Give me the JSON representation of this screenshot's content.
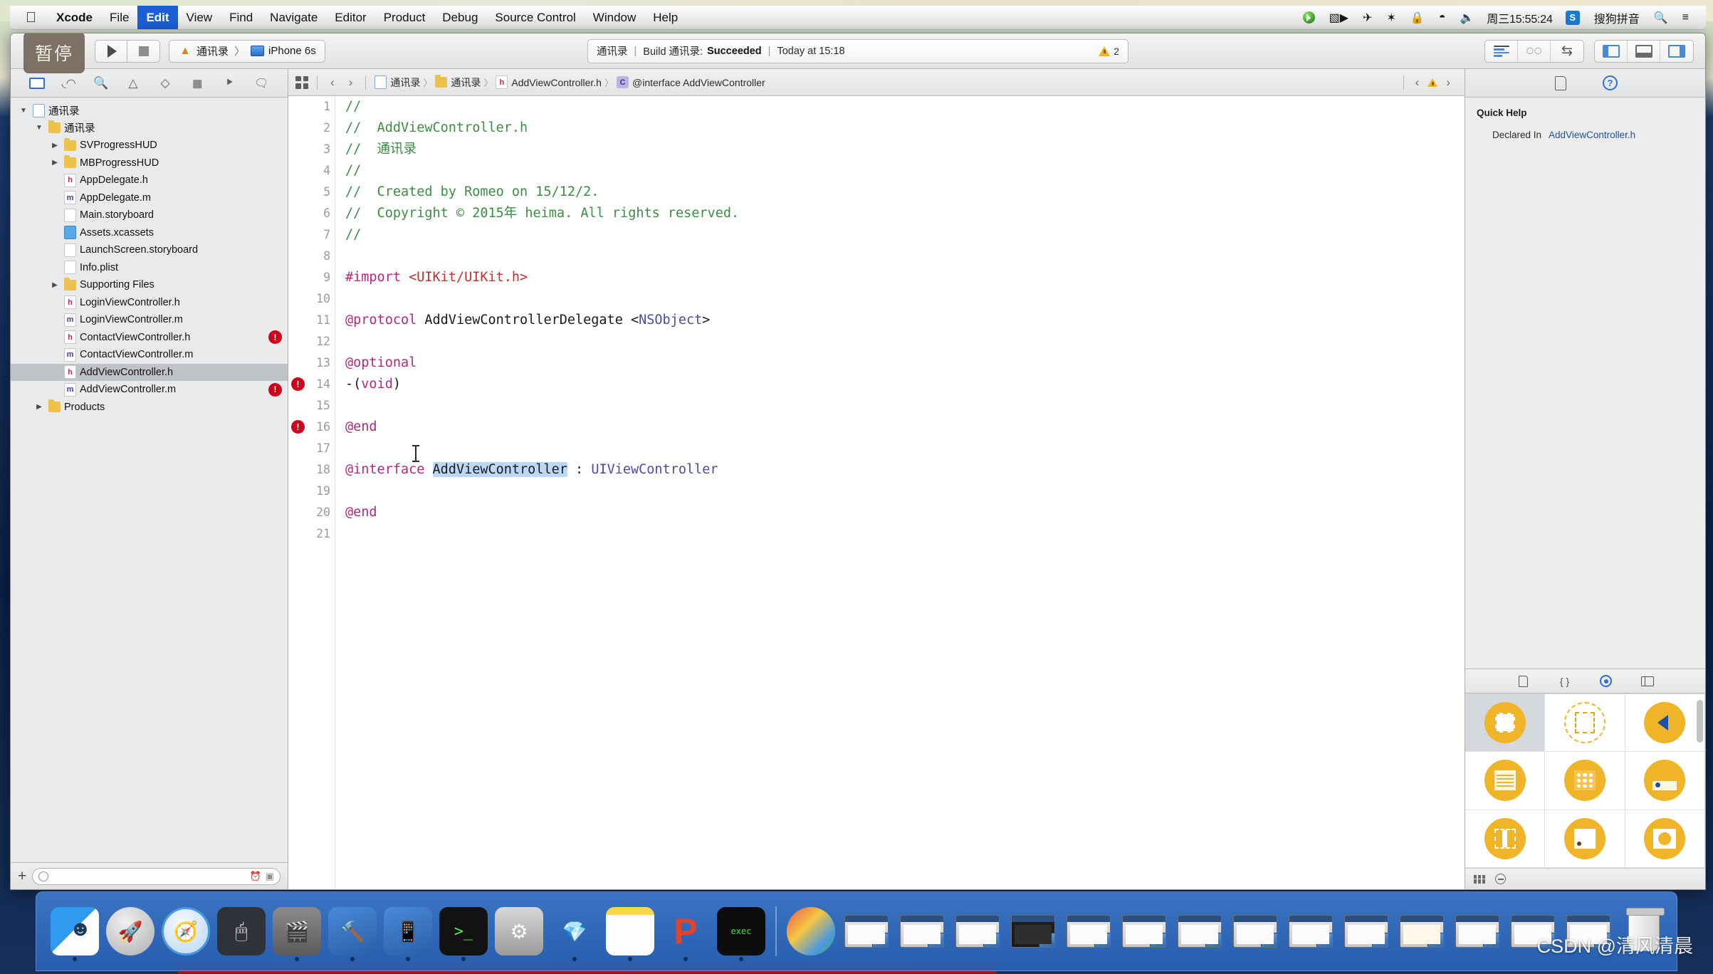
{
  "menubar": {
    "apple_icon": "apple-icon",
    "items": [
      {
        "label": "Xcode",
        "bold": true,
        "active": false
      },
      {
        "label": "File",
        "bold": false,
        "active": false
      },
      {
        "label": "Edit",
        "bold": false,
        "active": true
      },
      {
        "label": "View",
        "bold": false,
        "active": false
      },
      {
        "label": "Find",
        "bold": false,
        "active": false
      },
      {
        "label": "Navigate",
        "bold": false,
        "active": false
      },
      {
        "label": "Editor",
        "bold": false,
        "active": false
      },
      {
        "label": "Product",
        "bold": false,
        "active": false
      },
      {
        "label": "Debug",
        "bold": false,
        "active": false
      },
      {
        "label": "Source Control",
        "bold": false,
        "active": false
      },
      {
        "label": "Window",
        "bold": false,
        "active": false
      },
      {
        "label": "Help",
        "bold": false,
        "active": false
      }
    ],
    "status": {
      "screen_record_icon": "screen-record-icon",
      "airplane_icon": "airplane-mode-icon",
      "bluetooth_icon": "bluetooth-icon",
      "lock_icon": "lock-icon",
      "wifi_icon": "wifi-icon",
      "volume_icon": "volume-icon",
      "clock": "周三15:55:24",
      "input_method_badge": "S",
      "input_method": "搜狗拼音",
      "search_icon": "spotlight-search-icon",
      "notification_icon": "notification-center-icon"
    }
  },
  "toolbar": {
    "pause_tooltip": "暂停",
    "run_label": "run-button",
    "stop_label": "stop-button",
    "scheme": {
      "target": "通讯录",
      "separator": "〉",
      "destination": "iPhone 6s"
    },
    "status_bar": {
      "project": "通讯录",
      "sep": "|",
      "build_text": "Build 通讯录:",
      "result": "Succeeded",
      "time": "Today at 15:18",
      "warning_count": "2"
    },
    "editor_modes": [
      "standard-editor",
      "assistant-editor",
      "version-editor"
    ],
    "view_toggles": [
      "navigator-toggle",
      "debug-area-toggle",
      "utilities-toggle"
    ]
  },
  "navigator": {
    "tabs": [
      "project-navigator",
      "symbol-navigator",
      "find-navigator",
      "issue-navigator",
      "test-navigator",
      "debug-navigator",
      "breakpoint-navigator",
      "report-navigator"
    ],
    "tree": [
      {
        "label": "通讯录",
        "indent": 0,
        "twisty": "open",
        "icon": "proj",
        "selected": false,
        "error": false
      },
      {
        "label": "通讯录",
        "indent": 1,
        "twisty": "open",
        "icon": "folder",
        "selected": false,
        "error": false
      },
      {
        "label": "SVProgressHUD",
        "indent": 2,
        "twisty": "closed",
        "icon": "folder",
        "selected": false,
        "error": false
      },
      {
        "label": "MBProgressHUD",
        "indent": 2,
        "twisty": "closed",
        "icon": "folder",
        "selected": false,
        "error": false
      },
      {
        "label": "AppDelegate.h",
        "indent": 2,
        "twisty": "none",
        "icon": "h",
        "selected": false,
        "error": false
      },
      {
        "label": "AppDelegate.m",
        "indent": 2,
        "twisty": "none",
        "icon": "m",
        "selected": false,
        "error": false
      },
      {
        "label": "Main.storyboard",
        "indent": 2,
        "twisty": "none",
        "icon": "sb",
        "selected": false,
        "error": false
      },
      {
        "label": "Assets.xcassets",
        "indent": 2,
        "twisty": "none",
        "icon": "xc",
        "selected": false,
        "error": false
      },
      {
        "label": "LaunchScreen.storyboard",
        "indent": 2,
        "twisty": "none",
        "icon": "sb",
        "selected": false,
        "error": false
      },
      {
        "label": "Info.plist",
        "indent": 2,
        "twisty": "none",
        "icon": "plist",
        "selected": false,
        "error": false
      },
      {
        "label": "Supporting Files",
        "indent": 2,
        "twisty": "closed",
        "icon": "folder",
        "selected": false,
        "error": false
      },
      {
        "label": "LoginViewController.h",
        "indent": 2,
        "twisty": "none",
        "icon": "h",
        "selected": false,
        "error": false
      },
      {
        "label": "LoginViewController.m",
        "indent": 2,
        "twisty": "none",
        "icon": "m",
        "selected": false,
        "error": false
      },
      {
        "label": "ContactViewController.h",
        "indent": 2,
        "twisty": "none",
        "icon": "h",
        "selected": false,
        "error": true
      },
      {
        "label": "ContactViewController.m",
        "indent": 2,
        "twisty": "none",
        "icon": "m",
        "selected": false,
        "error": false
      },
      {
        "label": "AddViewController.h",
        "indent": 2,
        "twisty": "none",
        "icon": "h",
        "selected": true,
        "error": false
      },
      {
        "label": "AddViewController.m",
        "indent": 2,
        "twisty": "none",
        "icon": "m",
        "selected": false,
        "error": true
      },
      {
        "label": "Products",
        "indent": 1,
        "twisty": "closed",
        "icon": "folder",
        "selected": false,
        "error": false
      }
    ],
    "filter_placeholder": ""
  },
  "jumpbar": {
    "back_arrow": "‹",
    "forward_arrow": "›",
    "breadcrumb": [
      {
        "label": "通讯录",
        "icon": "proj"
      },
      {
        "label": "通讯录",
        "icon": "folder"
      },
      {
        "label": "AddViewController.h",
        "icon": "h"
      },
      {
        "label": "@interface AddViewController",
        "icon": "interface"
      }
    ],
    "issue_prev": "‹",
    "issue_next": "›"
  },
  "editor": {
    "filename": "AddViewController.h",
    "lines": [
      {
        "n": 1,
        "error": false,
        "tokens": [
          {
            "t": "//",
            "c": "cm"
          }
        ]
      },
      {
        "n": 2,
        "error": false,
        "tokens": [
          {
            "t": "//  AddViewController.h",
            "c": "cm"
          }
        ]
      },
      {
        "n": 3,
        "error": false,
        "tokens": [
          {
            "t": "//  通讯录",
            "c": "cm"
          }
        ]
      },
      {
        "n": 4,
        "error": false,
        "tokens": [
          {
            "t": "//",
            "c": "cm"
          }
        ]
      },
      {
        "n": 5,
        "error": false,
        "tokens": [
          {
            "t": "//  Created by Romeo on 15/12/2.",
            "c": "cm"
          }
        ]
      },
      {
        "n": 6,
        "error": false,
        "tokens": [
          {
            "t": "//  Copyright © 2015年 heima. All rights reserved.",
            "c": "cm"
          }
        ]
      },
      {
        "n": 7,
        "error": false,
        "tokens": [
          {
            "t": "//",
            "c": "cm"
          }
        ]
      },
      {
        "n": 8,
        "error": false,
        "tokens": []
      },
      {
        "n": 9,
        "error": false,
        "tokens": [
          {
            "t": "#import ",
            "c": "kw"
          },
          {
            "t": "<UIKit/UIKit.h>",
            "c": "str"
          }
        ]
      },
      {
        "n": 10,
        "error": false,
        "tokens": []
      },
      {
        "n": 11,
        "error": false,
        "tokens": [
          {
            "t": "@protocol",
            "c": "kw"
          },
          {
            "t": " AddViewControllerDelegate ",
            "c": "plain"
          },
          {
            "t": "<",
            "c": "plain"
          },
          {
            "t": "NSObject",
            "c": "typ"
          },
          {
            "t": ">",
            "c": "plain"
          }
        ]
      },
      {
        "n": 12,
        "error": false,
        "tokens": []
      },
      {
        "n": 13,
        "error": false,
        "tokens": [
          {
            "t": "@optional",
            "c": "kw"
          }
        ]
      },
      {
        "n": 14,
        "error": true,
        "tokens": [
          {
            "t": "-(",
            "c": "plain"
          },
          {
            "t": "void",
            "c": "kw"
          },
          {
            "t": ")",
            "c": "plain"
          }
        ]
      },
      {
        "n": 15,
        "error": false,
        "tokens": []
      },
      {
        "n": 16,
        "error": true,
        "tokens": [
          {
            "t": "@end",
            "c": "kw"
          }
        ]
      },
      {
        "n": 17,
        "error": false,
        "tokens": []
      },
      {
        "n": 18,
        "error": false,
        "tokens": [
          {
            "t": "@interface",
            "c": "kw"
          },
          {
            "t": " ",
            "c": "plain"
          },
          {
            "t": "AddViewController",
            "c": "plain sel-token"
          },
          {
            "t": " : ",
            "c": "plain"
          },
          {
            "t": "UIViewController",
            "c": "typ"
          }
        ]
      },
      {
        "n": 19,
        "error": false,
        "tokens": []
      },
      {
        "n": 20,
        "error": false,
        "tokens": [
          {
            "t": "@end",
            "c": "kw"
          }
        ]
      },
      {
        "n": 21,
        "error": false,
        "tokens": []
      }
    ]
  },
  "inspector": {
    "tabs": [
      "file-inspector",
      "quick-help-inspector"
    ],
    "quick_help": {
      "title": "Quick Help",
      "declared_in_label": "Declared In",
      "declared_in_value": "AddViewController.h"
    },
    "library": {
      "tabs": [
        "file-template-library",
        "code-snippet-library",
        "object-library",
        "media-library"
      ],
      "objects": [
        {
          "name": "view-controller",
          "selected": true
        },
        {
          "name": "storyboard-reference",
          "selected": false
        },
        {
          "name": "navigation-controller",
          "selected": false
        },
        {
          "name": "table-view-controller",
          "selected": false
        },
        {
          "name": "collection-view-controller",
          "selected": false
        },
        {
          "name": "tab-bar-controller",
          "selected": false
        },
        {
          "name": "split-view-controller",
          "selected": false
        },
        {
          "name": "page-view-controller",
          "selected": false
        },
        {
          "name": "glkit-view-controller",
          "selected": false
        }
      ]
    }
  },
  "dock": {
    "items": [
      {
        "name": "finder",
        "cls": "ic-finder",
        "glyph": "",
        "running": true,
        "type": "app"
      },
      {
        "name": "launchpad",
        "cls": "ic-launch",
        "glyph": "🚀",
        "running": false,
        "type": "app"
      },
      {
        "name": "safari",
        "cls": "ic-safari",
        "glyph": "🧭",
        "running": false,
        "type": "app"
      },
      {
        "name": "mouse-utility",
        "cls": "ic-mouse",
        "glyph": "🖱",
        "running": false,
        "type": "app"
      },
      {
        "name": "imovie",
        "cls": "ic-imovie",
        "glyph": "🎬",
        "running": true,
        "type": "app"
      },
      {
        "name": "xcode",
        "cls": "ic-xcode",
        "glyph": "🔨",
        "running": true,
        "type": "app"
      },
      {
        "name": "xcode-beta",
        "cls": "ic-xcode",
        "glyph": "📱",
        "running": true,
        "type": "app"
      },
      {
        "name": "terminal",
        "cls": "ic-term",
        "glyph": ">_",
        "running": true,
        "type": "app"
      },
      {
        "name": "system-preferences",
        "cls": "ic-prefs",
        "glyph": "⚙",
        "running": false,
        "type": "app"
      },
      {
        "name": "sketch",
        "cls": "ic-sketch",
        "glyph": "💎",
        "running": true,
        "type": "app"
      },
      {
        "name": "notes",
        "cls": "ic-notes",
        "glyph": "",
        "running": true,
        "type": "app"
      },
      {
        "name": "keynote",
        "cls": "ic-p",
        "glyph": "P",
        "running": true,
        "type": "app"
      },
      {
        "name": "exec-terminal",
        "cls": "ic-exec",
        "glyph": "exec",
        "running": true,
        "type": "app"
      },
      {
        "name": "separator",
        "cls": "",
        "glyph": "",
        "running": false,
        "type": "sep"
      },
      {
        "name": "chrome-window",
        "cls": "ic-chrome",
        "glyph": "",
        "running": false,
        "type": "app"
      },
      {
        "name": "minimized-window",
        "cls": "",
        "glyph": "",
        "running": false,
        "type": "win"
      },
      {
        "name": "minimized-window",
        "cls": "",
        "glyph": "",
        "running": false,
        "type": "win"
      },
      {
        "name": "minimized-window",
        "cls": "",
        "glyph": "",
        "running": false,
        "type": "win"
      },
      {
        "name": "minimized-window",
        "cls": "dark",
        "glyph": "",
        "running": false,
        "type": "win"
      },
      {
        "name": "minimized-window",
        "cls": "",
        "glyph": "",
        "running": false,
        "type": "win"
      },
      {
        "name": "minimized-window",
        "cls": "",
        "glyph": "",
        "running": false,
        "type": "win"
      },
      {
        "name": "minimized-window",
        "cls": "",
        "glyph": "",
        "running": false,
        "type": "win"
      },
      {
        "name": "minimized-window",
        "cls": "",
        "glyph": "",
        "running": false,
        "type": "win"
      },
      {
        "name": "minimized-window",
        "cls": "",
        "glyph": "",
        "running": false,
        "type": "win"
      },
      {
        "name": "minimized-window",
        "cls": "",
        "glyph": "",
        "running": false,
        "type": "win"
      },
      {
        "name": "minimized-window",
        "cls": "doc",
        "glyph": "",
        "running": false,
        "type": "win"
      },
      {
        "name": "minimized-window",
        "cls": "",
        "glyph": "",
        "running": false,
        "type": "win"
      },
      {
        "name": "minimized-window",
        "cls": "",
        "glyph": "",
        "running": false,
        "type": "win"
      },
      {
        "name": "minimized-window",
        "cls": "",
        "glyph": "",
        "running": false,
        "type": "win"
      },
      {
        "name": "trash",
        "cls": "ic-trash",
        "glyph": "",
        "running": false,
        "type": "trash"
      }
    ]
  },
  "watermark": "CSDN @清风清晨",
  "colors": {
    "accent_blue": "#1c5fd4",
    "comment_green": "#3c8c43",
    "keyword_magenta": "#b5277d",
    "string_red": "#c62f2f",
    "type_purple": "#4b4ba8",
    "error_red": "#d0021b",
    "warning_amber": "#f0b429",
    "selection_blue": "#bcd8f5",
    "object_yellow": "#f0b429"
  }
}
